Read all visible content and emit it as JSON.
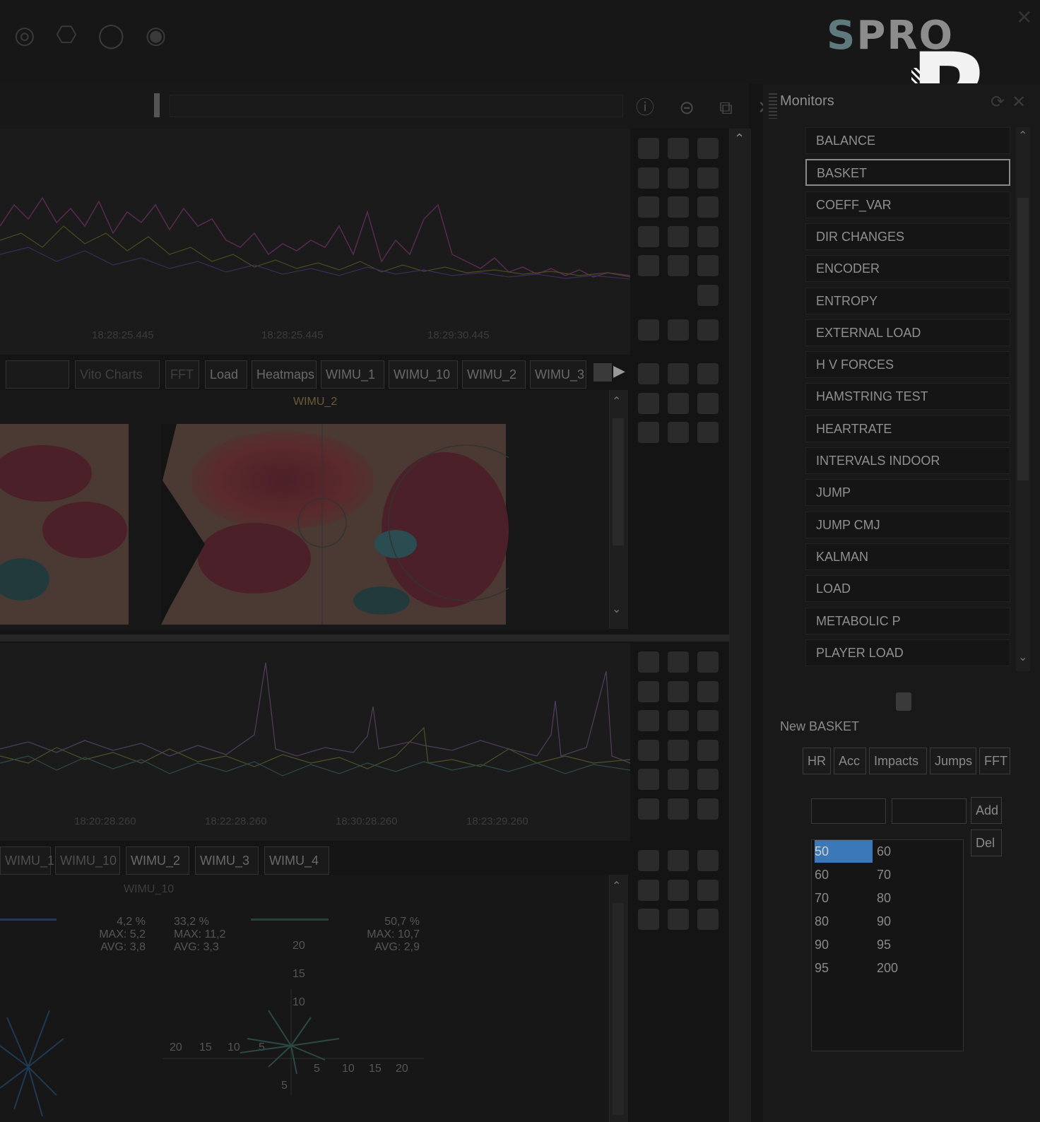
{
  "logo": {
    "brand": "SPRO",
    "mark": "R"
  },
  "monitors": {
    "title": "Monitors",
    "items": [
      "BALANCE",
      "BASKET",
      "COEFF_VAR",
      "DIR CHANGES",
      "ENCODER",
      "ENTROPY",
      "EXTERNAL LOAD",
      "H V FORCES",
      "HAMSTRING TEST",
      "HEARTRATE",
      "INTERVALS INDOOR",
      "JUMP",
      "JUMP CMJ",
      "KALMAN",
      "LOAD",
      "METABOLIC P",
      "PLAYER LOAD"
    ],
    "selected": "BASKET"
  },
  "basket": {
    "new_label": "New BASKET",
    "tabs": [
      "HR",
      "Acc",
      "Impacts",
      "Jumps",
      "FFT"
    ],
    "add_label": "Add",
    "del_label": "Del",
    "ranges": [
      {
        "min": "50",
        "max": "60"
      },
      {
        "min": "60",
        "max": "70"
      },
      {
        "min": "70",
        "max": "80"
      },
      {
        "min": "80",
        "max": "90"
      },
      {
        "min": "90",
        "max": "95"
      },
      {
        "min": "95",
        "max": "200"
      }
    ]
  },
  "chart1": {
    "times": [
      "18:28:25.445",
      "18:28:25.445",
      "18:29:30.445"
    ]
  },
  "middle_tabs": [
    "Load",
    "Heatmaps",
    "WIMU_1",
    "WIMU_10",
    "WIMU_2",
    "WIMU_3"
  ],
  "middle_dim_tabs": [
    "Vito Charts",
    "FFT"
  ],
  "heatmap_title": "WIMU_2",
  "chart2": {
    "times": [
      "18:20:28.260",
      "18:22:28.260",
      "18:30:28.260",
      "18:23:29.260"
    ]
  },
  "bottom_tabs": [
    "WIMU_1",
    "WIMU_10",
    "WIMU_2",
    "WIMU_3",
    "WIMU_4"
  ],
  "radar": {
    "title": "WIMU_10",
    "stats_left": [
      "4,2 %",
      "MAX: 5,2",
      "AVG: 3,8"
    ],
    "stats_mid": [
      "33,2 %",
      "MAX: 11,2",
      "AVG: 3,3"
    ],
    "stats_right": [
      "50,7 %",
      "MAX: 10,7",
      "AVG: 2,9"
    ],
    "y_ticks": [
      "20",
      "15",
      "10"
    ],
    "x_ticks_left": [
      "20",
      "15",
      "10",
      "5"
    ],
    "x_ticks_right": [
      "5",
      "10",
      "15",
      "20"
    ],
    "bottom_tick": "5"
  },
  "colors": {
    "accent_selected": "#3a78b8",
    "background": "#141414"
  }
}
